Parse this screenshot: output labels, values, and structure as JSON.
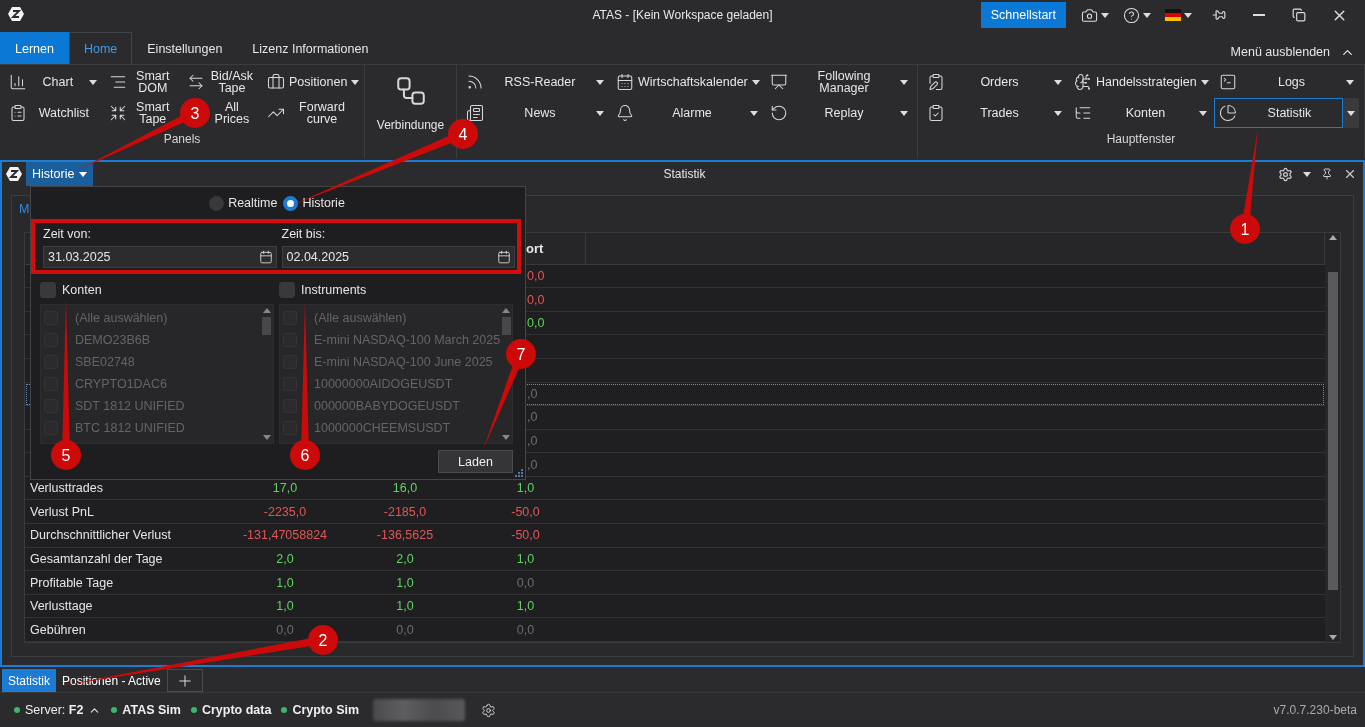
{
  "title_bar": {
    "title": "ATAS - [Kein Workspace geladen]",
    "quick_start": "Schnellstart"
  },
  "ribbon": {
    "tabs": [
      {
        "label": "Lernen",
        "kind": "accent",
        "selected": false
      },
      {
        "label": "Home",
        "kind": "tab",
        "selected": true
      },
      {
        "label": "Einstellungen",
        "kind": "tab",
        "selected": false
      },
      {
        "label": "Lizenz Informationen",
        "kind": "tab",
        "selected": false
      }
    ],
    "hide_menu": "Menü ausblenden",
    "groups": [
      {
        "kind": "small",
        "label": "Panels",
        "columns": [
          [
            {
              "label": "Chart",
              "dropdown": true,
              "selected": false
            },
            {
              "label": "Watchlist",
              "dropdown": false,
              "selected": false
            }
          ],
          [
            {
              "label": "Smart DOM",
              "dropdown": false,
              "selected": false
            },
            {
              "label": "Smart Tape",
              "dropdown": false,
              "selected": false
            }
          ],
          [
            {
              "label": "Bid/Ask Tape",
              "dropdown": false,
              "selected": false
            },
            {
              "label": "All Prices",
              "dropdown": false,
              "selected": false
            }
          ],
          [
            {
              "label": "Positionen",
              "dropdown": true,
              "selected": false
            },
            {
              "label": "Forward curve",
              "dropdown": false,
              "selected": false
            }
          ]
        ]
      },
      {
        "kind": "large",
        "columns": [
          [
            {
              "label": "Verbindunge",
              "dropdown": false,
              "selected": false
            }
          ]
        ]
      },
      {
        "kind": "small",
        "columns": [
          [
            {
              "label": "RSS-Reader",
              "dropdown": true,
              "selected": false
            },
            {
              "label": "News",
              "dropdown": true,
              "selected": false
            }
          ],
          [
            {
              "label": "Wirtschaftskalender",
              "dropdown": true,
              "selected": false
            },
            {
              "label": "Alarme",
              "dropdown": true,
              "selected": false
            }
          ],
          [
            {
              "label": "Following Manager",
              "dropdown": true,
              "selected": false
            },
            {
              "label": "Replay",
              "dropdown": true,
              "selected": false
            }
          ]
        ]
      },
      {
        "kind": "small",
        "label": "Hauptfenster",
        "columns": [
          [
            {
              "label": "Orders",
              "dropdown": true,
              "selected": false
            },
            {
              "label": "Trades",
              "dropdown": true,
              "selected": false
            }
          ],
          [
            {
              "label": "Handelsstrategien",
              "dropdown": true,
              "selected": false
            },
            {
              "label": "Konten",
              "dropdown": true,
              "selected": false
            }
          ],
          [
            {
              "label": "Logs",
              "dropdown": true,
              "selected": false
            },
            {
              "label": "Statistik",
              "dropdown": true,
              "selected": true
            }
          ]
        ]
      }
    ]
  },
  "panel": {
    "mode_dropdown": "Historie",
    "title": "Statistik",
    "tabs": [
      {
        "label": "M",
        "selected": true
      }
    ],
    "table": {
      "column_4_heading": "ort",
      "rows": [
        {
          "selected": false,
          "partial": {
            "text": "0,0",
            "color": "#e05656"
          }
        },
        {
          "selected": false,
          "partial": {
            "text": "0,0",
            "color": "#e05656"
          }
        },
        {
          "selected": false,
          "partial": {
            "text": "0,0",
            "color": "#5fd35f"
          }
        },
        {
          "selected": false
        },
        {
          "selected": false
        },
        {
          "selected": true,
          "partial": {
            "text": ",0",
            "color": "#6c6c6c"
          }
        },
        {
          "selected": false,
          "partial": {
            "text": ",0",
            "color": "#6c6c6c"
          }
        },
        {
          "selected": false,
          "partial": {
            "text": ",0",
            "color": "#6c6c6c"
          }
        },
        {
          "selected": false,
          "partial": {
            "text": ",0",
            "color": "#6c6c6c"
          }
        },
        {
          "selected": false,
          "label": "Verlusttrades",
          "values": [
            {
              "text": "17,0",
              "color": "#5fd35f"
            },
            {
              "text": "16,0",
              "color": "#5fd35f"
            },
            {
              "text": "1,0",
              "color": "#5fd35f"
            }
          ]
        },
        {
          "selected": false,
          "label": "Verlust PnL",
          "values": [
            {
              "text": "-2235,0",
              "color": "#e05656"
            },
            {
              "text": "-2185,0",
              "color": "#e05656"
            },
            {
              "text": "-50,0",
              "color": "#e05656"
            }
          ]
        },
        {
          "selected": false,
          "label": "Durchschnittlicher Verlust",
          "values": [
            {
              "text": "-131,47058824",
              "color": "#e05656"
            },
            {
              "text": "-136,5625",
              "color": "#e05656"
            },
            {
              "text": "-50,0",
              "color": "#e05656"
            }
          ]
        },
        {
          "selected": false,
          "label": "Gesamtanzahl der Tage",
          "values": [
            {
              "text": "2,0",
              "color": "#5fd35f"
            },
            {
              "text": "2,0",
              "color": "#5fd35f"
            },
            {
              "text": "1,0",
              "color": "#5fd35f"
            }
          ]
        },
        {
          "selected": false,
          "label": "Profitable Tage",
          "values": [
            {
              "text": "1,0",
              "color": "#5fd35f"
            },
            {
              "text": "1,0",
              "color": "#5fd35f"
            },
            {
              "text": "0,0",
              "color": "#6c6c6c"
            }
          ]
        },
        {
          "selected": false,
          "label": "Verlusttage",
          "values": [
            {
              "text": "1,0",
              "color": "#5fd35f"
            },
            {
              "text": "1,0",
              "color": "#5fd35f"
            },
            {
              "text": "1,0",
              "color": "#5fd35f"
            }
          ]
        },
        {
          "selected": false,
          "label": "Gebühren",
          "values": [
            {
              "text": "0,0",
              "color": "#6c6c6c"
            },
            {
              "text": "0,0",
              "color": "#6c6c6c"
            },
            {
              "text": "0,0",
              "color": "#6c6c6c"
            }
          ]
        }
      ]
    }
  },
  "filter_popup": {
    "modes": [
      {
        "label": "Realtime",
        "selected": false
      },
      {
        "label": "Historie",
        "selected": true
      }
    ],
    "date_range": {
      "highlighted": true,
      "from_label": "Zeit von:",
      "from": "31.03.2025",
      "to_label": "Zeit bis:",
      "to": "02.04.2025"
    },
    "lists": [
      {
        "label": "Konten",
        "checked": false,
        "disabled": true,
        "items": [
          {
            "label": "(Alle auswählen)",
            "checked": false
          },
          {
            "label": "DEMO23B6B",
            "checked": false
          },
          {
            "label": "SBE02748",
            "checked": false
          },
          {
            "label": "CRYPTO1DAC6",
            "checked": false
          },
          {
            "label": "SDT 1812 UNIFIED",
            "checked": false
          },
          {
            "label": "BTC 1812 UNIFIED",
            "checked": false
          }
        ]
      },
      {
        "label": "Instruments",
        "checked": false,
        "disabled": true,
        "items": [
          {
            "label": "(Alle auswählen)",
            "checked": false
          },
          {
            "label": "E-mini NASDAQ-100 March 2025",
            "checked": false
          },
          {
            "label": "E-mini NASDAQ-100 June 2025",
            "checked": false
          },
          {
            "label": "10000000AIDOGEUSDT",
            "checked": false
          },
          {
            "label": "000000BABYDOGEUSDT",
            "checked": false
          },
          {
            "label": "1000000CHEEMSUSDT",
            "checked": false
          }
        ]
      }
    ],
    "load_button": "Laden"
  },
  "bottom_tabs": [
    {
      "label": "Statistik",
      "selected": true
    },
    {
      "label": "Positionen - Active",
      "selected": false
    }
  ],
  "status_bar": {
    "connections": [
      {
        "label": "Server: **F2**",
        "bold": false,
        "color": "#3fb56a"
      },
      {
        "label": "ATAS Sim",
        "bold": true,
        "color": "#3fb56a"
      },
      {
        "label": "Crypto data",
        "bold": true,
        "color": "#3fb56a"
      },
      {
        "label": "Crypto Sim",
        "bold": true,
        "color": "#3fb56a"
      }
    ],
    "version": "v7.0.7.230-beta"
  },
  "callouts": [
    {
      "label": "1"
    },
    {
      "label": "2"
    },
    {
      "label": "3"
    },
    {
      "label": "4"
    },
    {
      "label": "5"
    },
    {
      "label": "6"
    },
    {
      "label": "7"
    }
  ]
}
